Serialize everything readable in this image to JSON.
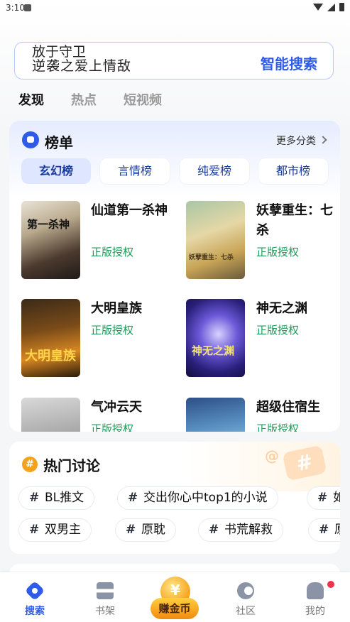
{
  "status_bar": {
    "time": "3:10"
  },
  "search": {
    "placeholder_line1": "放于守卫",
    "placeholder_line2": "逆袭之爱上情敌",
    "button": "智能搜索"
  },
  "tabs": [
    {
      "label": "发现",
      "active": true
    },
    {
      "label": "热点",
      "active": false
    },
    {
      "label": "短视频",
      "active": false
    }
  ],
  "ranking": {
    "title": "榜单",
    "more": "更多分类",
    "categories": [
      {
        "label": "玄幻榜",
        "active": true
      },
      {
        "label": "言情榜",
        "active": false
      },
      {
        "label": "纯爱榜",
        "active": false
      },
      {
        "label": "都市榜",
        "active": false
      }
    ],
    "books": [
      {
        "title": "仙道第一杀神",
        "tag": "正版授权",
        "cover_text": "第一杀神"
      },
      {
        "title": "妖孽重生：七杀",
        "tag": "正版授权",
        "cover_text": "妖孽重生：七杀"
      },
      {
        "title": "大明皇族",
        "tag": "正版授权",
        "cover_text": "大明皇族"
      },
      {
        "title": "神无之渊",
        "tag": "正版授权",
        "cover_text": "神无之渊"
      },
      {
        "title": "气冲云天",
        "tag": "正版授权",
        "cover_text": ""
      },
      {
        "title": "超级住宿生",
        "tag": "正版授权",
        "cover_text": ""
      }
    ]
  },
  "discussion": {
    "title": "热门讨论",
    "row1": [
      "BL推文",
      "交出你心中top1的小说",
      "如"
    ],
    "row2": [
      "双男主",
      "原耽",
      "书荒解救",
      "原"
    ]
  },
  "bottom_nav": [
    {
      "label": "搜索",
      "active": true
    },
    {
      "label": "书架",
      "active": false
    },
    {
      "label": "赚金币",
      "active": false
    },
    {
      "label": "社区",
      "active": false
    },
    {
      "label": "我的",
      "active": false
    }
  ],
  "colors": {
    "accent": "#2f5bea",
    "tag_green": "#1e9a5a",
    "hot_orange": "#f4a21d"
  }
}
